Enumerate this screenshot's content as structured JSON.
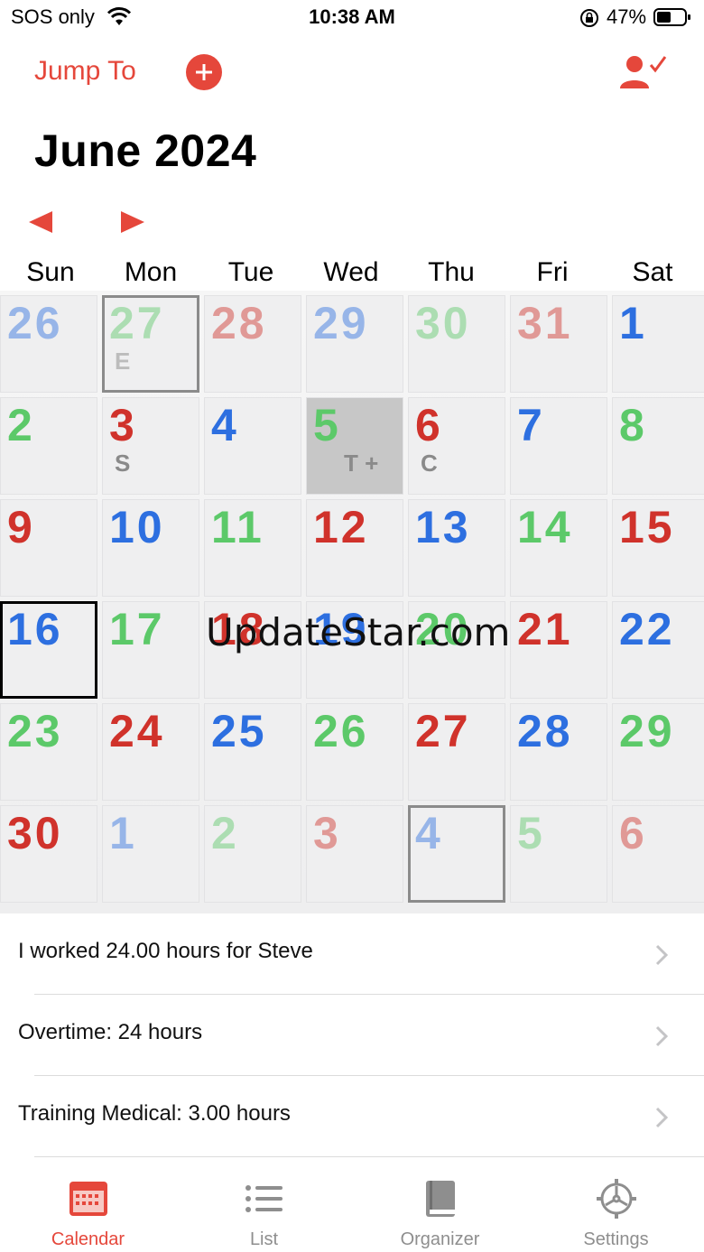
{
  "status_bar": {
    "carrier": "SOS only",
    "time": "10:38 AM",
    "battery": "47%",
    "icons": [
      "wifi-icon",
      "orientation-lock-icon",
      "battery-icon"
    ]
  },
  "header": {
    "jump_to": "Jump To",
    "add_icon": "plus-circle-icon",
    "user_icon": "person-check-icon"
  },
  "calendar": {
    "month_title": "June 2024",
    "prev_icon": "triangle-left-icon",
    "next_icon": "triangle-right-icon",
    "weekdays": [
      "Sun",
      "Mon",
      "Tue",
      "Wed",
      "Thu",
      "Fri",
      "Sat"
    ],
    "weeks": [
      [
        {
          "day": "26",
          "color": "blue",
          "faded": true
        },
        {
          "day": "27",
          "color": "green",
          "faded": true,
          "tag": "E",
          "outlined": true
        },
        {
          "day": "28",
          "color": "red",
          "faded": true
        },
        {
          "day": "29",
          "color": "blue",
          "faded": true
        },
        {
          "day": "30",
          "color": "green",
          "faded": true
        },
        {
          "day": "31",
          "color": "red",
          "faded": true
        },
        {
          "day": "1",
          "color": "blue"
        }
      ],
      [
        {
          "day": "2",
          "color": "green"
        },
        {
          "day": "3",
          "color": "red",
          "tag": "S"
        },
        {
          "day": "4",
          "color": "blue"
        },
        {
          "day": "5",
          "color": "green",
          "tag": "T +",
          "shaded": true
        },
        {
          "day": "6",
          "color": "red",
          "tag": "C"
        },
        {
          "day": "7",
          "color": "blue"
        },
        {
          "day": "8",
          "color": "green"
        }
      ],
      [
        {
          "day": "9",
          "color": "red"
        },
        {
          "day": "10",
          "color": "blue"
        },
        {
          "day": "11",
          "color": "green"
        },
        {
          "day": "12",
          "color": "red"
        },
        {
          "day": "13",
          "color": "blue"
        },
        {
          "day": "14",
          "color": "green"
        },
        {
          "day": "15",
          "color": "red"
        }
      ],
      [
        {
          "day": "16",
          "color": "blue",
          "today": true
        },
        {
          "day": "17",
          "color": "green"
        },
        {
          "day": "18",
          "color": "red"
        },
        {
          "day": "19",
          "color": "blue"
        },
        {
          "day": "20",
          "color": "green"
        },
        {
          "day": "21",
          "color": "red"
        },
        {
          "day": "22",
          "color": "blue"
        }
      ],
      [
        {
          "day": "23",
          "color": "green"
        },
        {
          "day": "24",
          "color": "red"
        },
        {
          "day": "25",
          "color": "blue"
        },
        {
          "day": "26",
          "color": "green"
        },
        {
          "day": "27",
          "color": "red"
        },
        {
          "day": "28",
          "color": "blue"
        },
        {
          "day": "29",
          "color": "green"
        }
      ],
      [
        {
          "day": "30",
          "color": "red"
        },
        {
          "day": "1",
          "color": "blue",
          "faded": true
        },
        {
          "day": "2",
          "color": "green",
          "faded": true
        },
        {
          "day": "3",
          "color": "red",
          "faded": true
        },
        {
          "day": "4",
          "color": "blue",
          "faded": true,
          "outlined": true
        },
        {
          "day": "5",
          "color": "green",
          "faded": true
        },
        {
          "day": "6",
          "color": "red",
          "faded": true
        }
      ]
    ]
  },
  "watermark": "UpdateStar.com",
  "events": [
    {
      "text": "I worked 24.00 hours for Steve"
    },
    {
      "text": "Overtime: 24 hours"
    },
    {
      "text": "Training Medical: 3.00 hours"
    }
  ],
  "tabbar": {
    "tabs": [
      {
        "label": "Calendar",
        "icon": "calendar-icon",
        "active": true
      },
      {
        "label": "List",
        "icon": "list-icon",
        "active": false
      },
      {
        "label": "Organizer",
        "icon": "book-icon",
        "active": false
      },
      {
        "label": "Settings",
        "icon": "gear-icon",
        "active": false
      }
    ]
  },
  "colors": {
    "accent": "#e5473b",
    "blue": "#2d6fe0",
    "green": "#5cc969",
    "red": "#d0322b"
  }
}
